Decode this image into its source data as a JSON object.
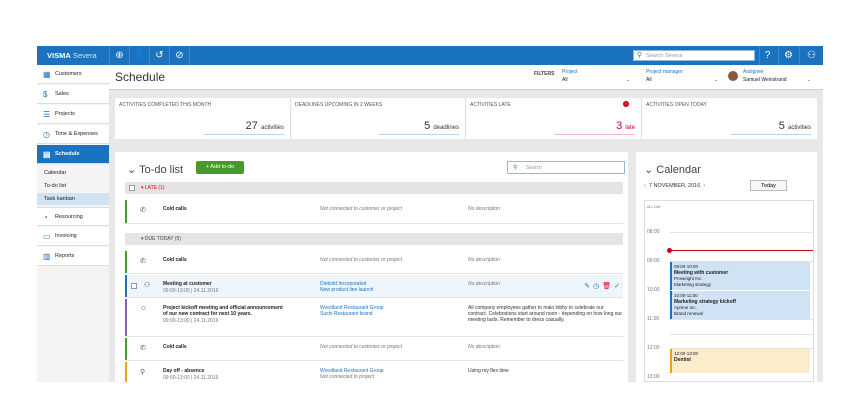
{
  "brand": {
    "name": "VISMA",
    "product": "Severa"
  },
  "topbar": {
    "search_placeholder": "Search Severa"
  },
  "sidebar": {
    "items": [
      {
        "label": "Customers",
        "icon": "building-icon"
      },
      {
        "label": "Sales",
        "icon": "dollar-icon"
      },
      {
        "label": "Projects",
        "icon": "projects-icon"
      },
      {
        "label": "Time & Expenses",
        "icon": "clock-icon"
      },
      {
        "label": "Schedule",
        "icon": "calendar-icon"
      }
    ],
    "sub": [
      "Calendar",
      "To-do list",
      "Task kanban"
    ],
    "items2": [
      {
        "label": "Resourcing",
        "icon": "resourcing-icon"
      },
      {
        "label": "Invoicing",
        "icon": "invoice-icon"
      },
      {
        "label": "Reports",
        "icon": "chart-icon"
      }
    ]
  },
  "header": {
    "title": "Schedule",
    "filters_label": "FILTERS",
    "project": {
      "label": "Project",
      "value": "All"
    },
    "manager": {
      "label": "Project manager",
      "value": "All"
    },
    "assignee": {
      "label": "Assignee",
      "value": "Samuel Weinstrand"
    }
  },
  "stats": [
    {
      "label": "Activities completed this month",
      "value": "27",
      "unit": "activities"
    },
    {
      "label": "Deadlines upcoming in 2 weeks",
      "value": "5",
      "unit": "deadlines"
    },
    {
      "label": "Activities late",
      "value": "3",
      "unit": "late",
      "badge": "!"
    },
    {
      "label": "Activities open today",
      "value": "5",
      "unit": "activities"
    }
  ],
  "todo": {
    "title": "To-do list",
    "add_label": "+ Add to-do",
    "search_placeholder": "Search",
    "late_label": "LATE (1)",
    "due_label": "DUE TODAY (5)",
    "rows": [
      {
        "name": "Cold calls",
        "time": "",
        "customer": "Not connected to customer or project",
        "project": "",
        "desc": "No description",
        "color": "#4a9a29"
      },
      {
        "name": "Cold calls",
        "time": "",
        "customer": "Not connected to customer or project",
        "project": "",
        "desc": "No description",
        "color": "#4a9a29"
      },
      {
        "name": "Meeting at customer",
        "time": "09:00-13:00  |  24.11.2016",
        "customer": "Diebold Incorporated",
        "project": "New product line launch",
        "desc": "No description",
        "color": "#1b73c0"
      },
      {
        "name": "Project kickoff meeting and official announcement of our new contract for next 10 years.",
        "time": "09:00-13:00  |  24.11.2016",
        "customer": "Woodland Restaurant Group",
        "project": "Sushi Restaurant brand",
        "desc": "All company employees gather to main lobby to celebrate our contract. Celebrations start around noon - depending on how long our meeting lasts. Remember to dress casually.",
        "color": "#8b5fbf"
      },
      {
        "name": "Cold calls",
        "time": "",
        "customer": "Not connected to customer or project",
        "project": "",
        "desc": "No description",
        "color": "#4a9a29"
      },
      {
        "name": "Day off - absence",
        "time": "09:00-13:00  |  24.11.2016",
        "customer": "Woodland Restaurant Group",
        "project": "Not connected to project",
        "desc": "Using my flex time",
        "color": "#e8a317"
      }
    ]
  },
  "calendar": {
    "title": "Calendar",
    "date": "7 NOVEMBER, 2016",
    "today_label": "Today",
    "allday": "ALL DAY",
    "hours": [
      "08:00",
      "09:00",
      "10:00",
      "11:00",
      "12:00",
      "13:00"
    ],
    "events": [
      {
        "time": "09:00-10:00",
        "title": "Meeting with customer",
        "l1": "Proweight Inc.",
        "l2": "Marketing strategy"
      },
      {
        "time": "10:00-11:00",
        "title": "Marketing strategy kickoff",
        "l1": "Aprime Inc.",
        "l2": "Brand renewal"
      },
      {
        "time": "12:00-13:00",
        "title": "Dentist",
        "l1": "",
        "l2": ""
      }
    ]
  },
  "colors": {
    "accent": "#1b73c0",
    "late": "#d0011b",
    "add": "#4a9a29"
  }
}
